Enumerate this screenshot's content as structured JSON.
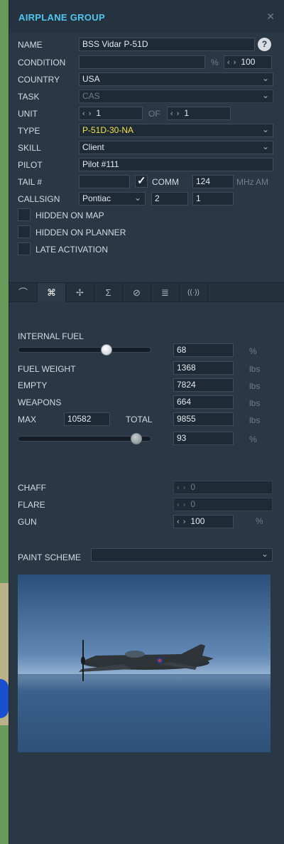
{
  "header": {
    "title": "AIRPLANE GROUP",
    "close_icon": "close-icon"
  },
  "form": {
    "name_label": "NAME",
    "name_value": "BSS Vidar P-51D",
    "help": "?",
    "condition_label": "CONDITION",
    "condition_value": "",
    "condition_unit": "%",
    "condition_pct": "100",
    "country_label": "COUNTRY",
    "country_value": "USA",
    "task_label": "TASK",
    "task_value": "CAS",
    "unit_label": "UNIT",
    "unit_value": "1",
    "of_label": "OF",
    "unit_of_value": "1",
    "type_label": "TYPE",
    "type_value": "P-51D-30-NA",
    "skill_label": "SKILL",
    "skill_value": "Client",
    "pilot_label": "PILOT",
    "pilot_value": "Pilot #111",
    "tail_label": "TAIL #",
    "tail_value": "",
    "comm_label": "COMM",
    "comm_checked": true,
    "comm_value": "124",
    "comm_unit": "MHz",
    "comm_mod": "AM",
    "callsign_label": "CALLSIGN",
    "callsign_value": "Pontiac",
    "callsign_num1": "2",
    "callsign_num2": "1",
    "hidden_map_label": "HIDDEN ON MAP",
    "hidden_planner_label": "HIDDEN ON PLANNER",
    "late_activation_label": "LATE ACTIVATION"
  },
  "tabs": [
    {
      "icon": "route-icon",
      "glyph": "⌒"
    },
    {
      "icon": "payload-icon",
      "glyph": "⌘"
    },
    {
      "icon": "waypoints-icon",
      "glyph": "✢"
    },
    {
      "icon": "summary-icon",
      "glyph": "Σ"
    },
    {
      "icon": "failures-icon",
      "glyph": "⊘"
    },
    {
      "icon": "briefing-icon",
      "glyph": "≣"
    },
    {
      "icon": "radio-icon",
      "glyph": "((·))"
    }
  ],
  "fuel": {
    "internal_fuel_label": "INTERNAL FUEL",
    "internal_fuel_value": "68",
    "internal_fuel_unit": "%",
    "internal_fuel_fraction": 0.68,
    "fuel_weight_label": "FUEL WEIGHT",
    "fuel_weight_value": "1368",
    "fuel_weight_unit": "lbs",
    "empty_label": "EMPTY",
    "empty_value": "7824",
    "empty_unit": "lbs",
    "weapons_label": "WEAPONS",
    "weapons_value": "664",
    "weapons_unit": "lbs",
    "max_label": "MAX",
    "max_value": "10582",
    "total_label": "TOTAL",
    "total_value": "9855",
    "total_unit": "lbs",
    "load_value": "93",
    "load_unit": "%",
    "load_fraction": 0.93
  },
  "countermeasures": {
    "chaff_label": "CHAFF",
    "chaff_value": "0",
    "flare_label": "FLARE",
    "flare_value": "0",
    "gun_label": "GUN",
    "gun_value": "100",
    "gun_unit": "%"
  },
  "paint": {
    "label": "PAINT SCHEME",
    "value": ""
  },
  "colors": {
    "accent": "#4fc6ef",
    "type_highlight": "#f2e34a",
    "panel_bg": "#2a3744"
  }
}
